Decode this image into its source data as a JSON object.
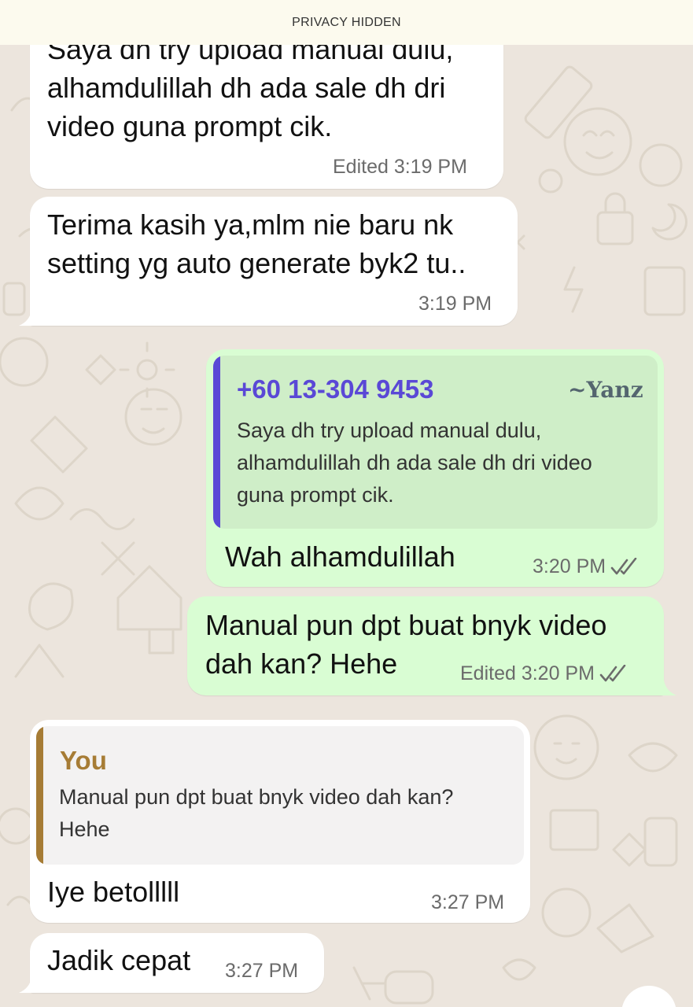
{
  "privacy_banner": "PRIVACY HIDDEN",
  "colors": {
    "chat_background": "#ece5dd",
    "incoming_bubble": "#ffffff",
    "outgoing_bubble": "#d9fdd3",
    "quote_outgoing_bg": "#cfeec8",
    "quote_outgoing_bar": "#5a48d6",
    "quote_incoming_bg": "#f3f2f2",
    "quote_incoming_bar": "#a67c35",
    "read_ticks": "#6b6b6b"
  },
  "messages": [
    {
      "direction": "incoming",
      "lines": [
        "Saya dh try upload manual dulu,",
        "alhamdulillah dh ada sale dh dri",
        "video guna prompt cik."
      ],
      "time": "Edited 3:19 PM"
    },
    {
      "direction": "incoming",
      "lines": [
        "Terima kasih ya,mlm nie baru nk",
        "setting yg auto generate byk2 tu.."
      ],
      "time": "3:19 PM"
    },
    {
      "direction": "outgoing",
      "quote": {
        "sender": "+60 13-304 9453",
        "push_name": "~Yanz",
        "lines": [
          "Saya dh try upload manual dulu,",
          "alhamdulillah dh ada sale dh dri video",
          "guna prompt cik."
        ]
      },
      "lines": [
        "Wah alhamdulillah"
      ],
      "time": "3:20 PM",
      "status_icon": "double-check-icon"
    },
    {
      "direction": "outgoing",
      "lines": [
        "Manual pun dpt buat bnyk video",
        "dah kan? Hehe"
      ],
      "time": "Edited 3:20 PM",
      "status_icon": "double-check-icon"
    },
    {
      "direction": "incoming",
      "quote": {
        "sender": "You",
        "lines": [
          "Manual pun dpt buat bnyk video dah kan?",
          "Hehe"
        ]
      },
      "lines": [
        "Iye betolllll"
      ],
      "time": "3:27 PM"
    },
    {
      "direction": "incoming",
      "lines": [
        "Jadik cepat"
      ],
      "time": "3:27 PM"
    }
  ]
}
